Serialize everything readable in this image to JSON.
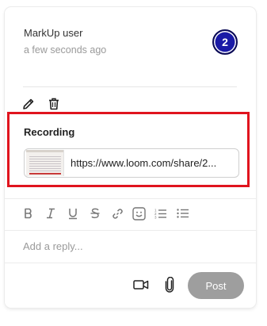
{
  "comment": {
    "author": "MarkUp user",
    "timestamp": "a few seconds ago",
    "badge_number": "2",
    "badge_color": "#1a1aa6"
  },
  "actions": {
    "edit_icon": "pencil-icon",
    "delete_icon": "trash-icon"
  },
  "recording": {
    "title": "Recording",
    "url": "https://www.loom.com/share/2...",
    "highlight_color": "#e0141e"
  },
  "toolbar": {
    "items": [
      "bold-icon",
      "italic-icon",
      "underline-icon",
      "strikethrough-icon",
      "link-icon",
      "emoji-icon",
      "numbered-list-icon",
      "bullet-list-icon"
    ]
  },
  "reply": {
    "placeholder": "Add a reply..."
  },
  "footer": {
    "video_icon": "video-camera-icon",
    "attach_icon": "paperclip-icon",
    "post_label": "Post",
    "post_color": "#9e9e9e"
  }
}
